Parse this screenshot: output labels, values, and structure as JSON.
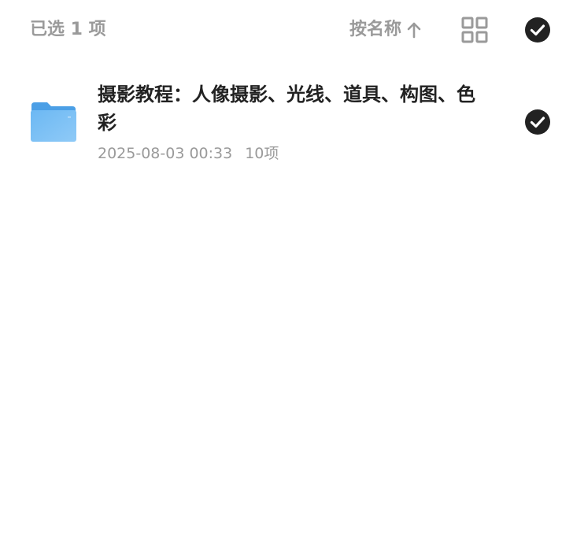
{
  "header": {
    "selected_label": "已选 1 项",
    "sort_label": "按名称",
    "sort_direction": "ascending",
    "grid_icon": "grid-view-icon",
    "select_all_icon": "check-circle-icon"
  },
  "items": [
    {
      "icon": "folder-icon",
      "name": "摄影教程：人像摄影、光线、道具、构图、色彩",
      "date": "2025-08-03 00:33",
      "count": "10项",
      "selected": true
    }
  ],
  "colors": {
    "muted_text": "#9a9a9a",
    "title_text": "#222222",
    "check_fill": "#222222",
    "folder_blue": "#5aaef0"
  }
}
